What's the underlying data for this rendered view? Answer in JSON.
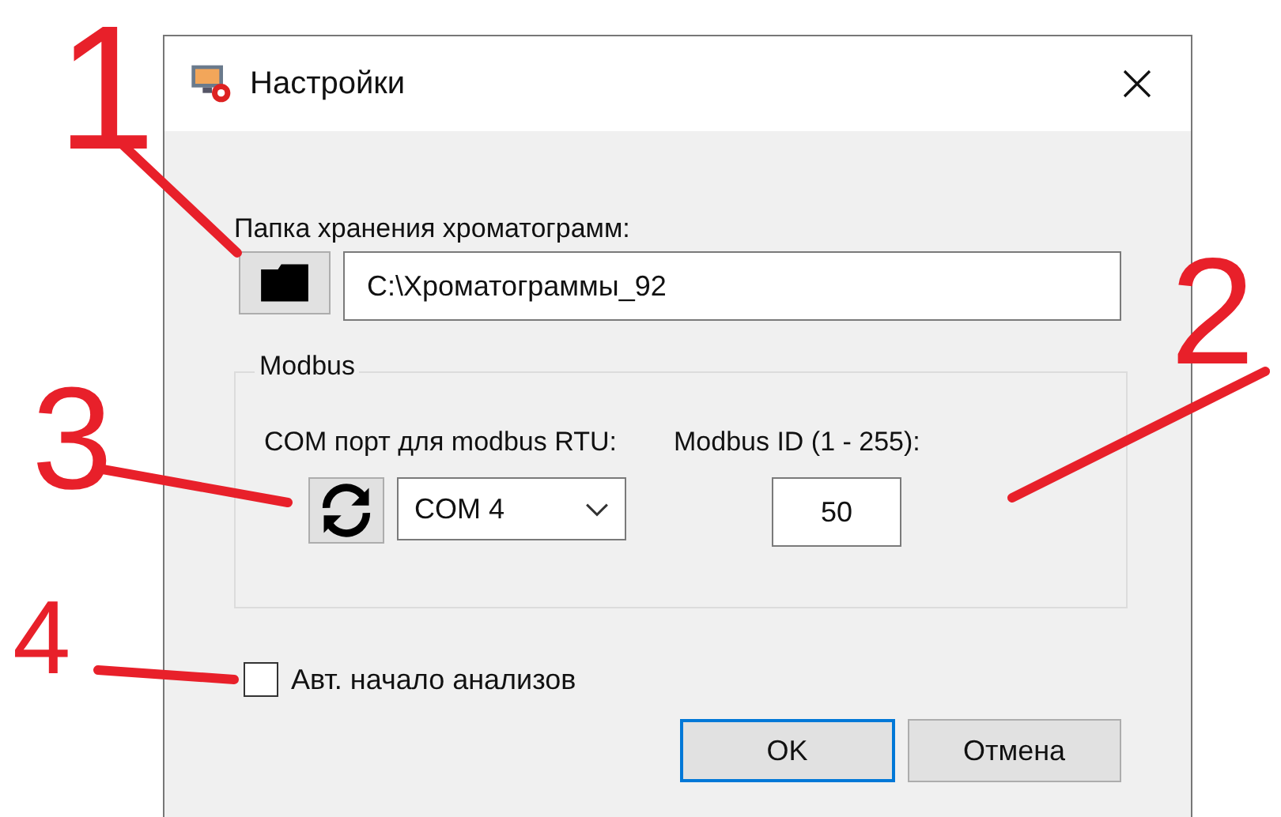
{
  "window": {
    "title": "Настройки"
  },
  "folder": {
    "label": "Папка хранения хроматограмм:",
    "value": "C:\\Хроматограммы_92"
  },
  "modbus": {
    "title": "Modbus",
    "com_label": "COM порт для modbus RTU:",
    "com_port": "COM 4",
    "id_label": "Modbus ID (1 - 255):",
    "id_value": "50"
  },
  "auto_start": {
    "label": "Авт. начало анализов",
    "checked": false
  },
  "buttons": [
    {
      "label": "OK",
      "focused": true
    },
    {
      "label": "Отмена",
      "focused": false
    }
  ],
  "callouts": [
    {
      "number": "1"
    },
    {
      "number": "2"
    },
    {
      "number": "3"
    },
    {
      "number": "4"
    }
  ]
}
